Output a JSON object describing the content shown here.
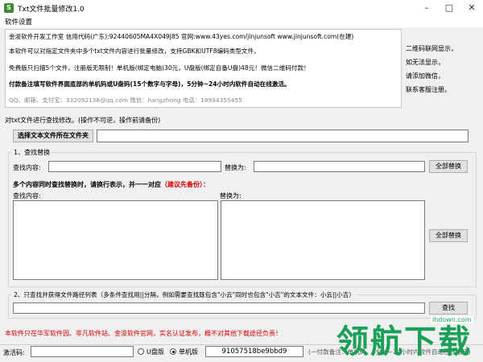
{
  "window": {
    "title": "Txt文件批量修改1.0",
    "icon_letter": "S"
  },
  "menu": {
    "settings": "软件设置"
  },
  "info": {
    "line1": "金浚软件开发工作室  信用代码(广东):92440605MA4X049J85  官网:www.43yes.com/jinjunsoft  www.jinjunsoft.com(在建)",
    "line2": "本软件可以对指定文件夹中多个txt文件内容进行批量修改，支持GBK和UTF8编码类型文件。",
    "line3": "免费版只扫描5个文件，注册版无限制！单机版(绑定电脑)30元，U盘版(绑定自备U盘)48元！微信二维码付款！",
    "line4": "付款备注填写软件界面底部的单机码或U盘码(15个数字与字母)，5分钟~24小时内软件自动在线激活。",
    "contact": "QQ、邮箱、支付宝：332092136@qq.com    微信：hangzhong    电话：18934355455"
  },
  "side_notes": [
    "二维码联网显示，",
    "如无法显示，",
    "请添加微信，",
    "联系客服注册。"
  ],
  "operation_label": "对txt文件进行查找修改。(操作不可逆，操作前请备份)",
  "choose_folder_button": "选择文本文件所在文件夹",
  "folder_path": "",
  "find_replace": {
    "group_title": "1、查找替换",
    "find_label": "查找内容:",
    "find_value": "",
    "replace_label": "替换为:",
    "replace_value": "",
    "replace_all_button": "全部替换",
    "multi_note": "多个内容同时查找替换时，请换行表示，并一一对应",
    "multi_note_hint": "（建议先备份）：",
    "multi_find_label": "查找内容:",
    "multi_replace_label": "替换为:",
    "multi_replace_all_button": "全部替换"
  },
  "search_list": {
    "group_title": "2、只查找并获得文件路径列表（多条件查找用||分隔，例如需要查找既包含\"小云\"同时也包含\"小吉\"的文本文件：小云||小吉）",
    "query_value": "",
    "search_button": "查找"
  },
  "notice": "本软件只在华军软件园、非凡软件站、金浚软件官网，实名认证发布，概不对其他下载途径负责！",
  "status": {
    "activation_label": "激活码:",
    "activation_value": "",
    "usb_version": "U盘版",
    "standalone_version": "单机版",
    "machine_code": "91057518be9bbd9",
    "hint": "(一付款备注：单机码，5分钟~24小时内软件自动在线激活)"
  },
  "watermark": {
    "main": "领航下载",
    "url": "lhdown.com"
  }
}
